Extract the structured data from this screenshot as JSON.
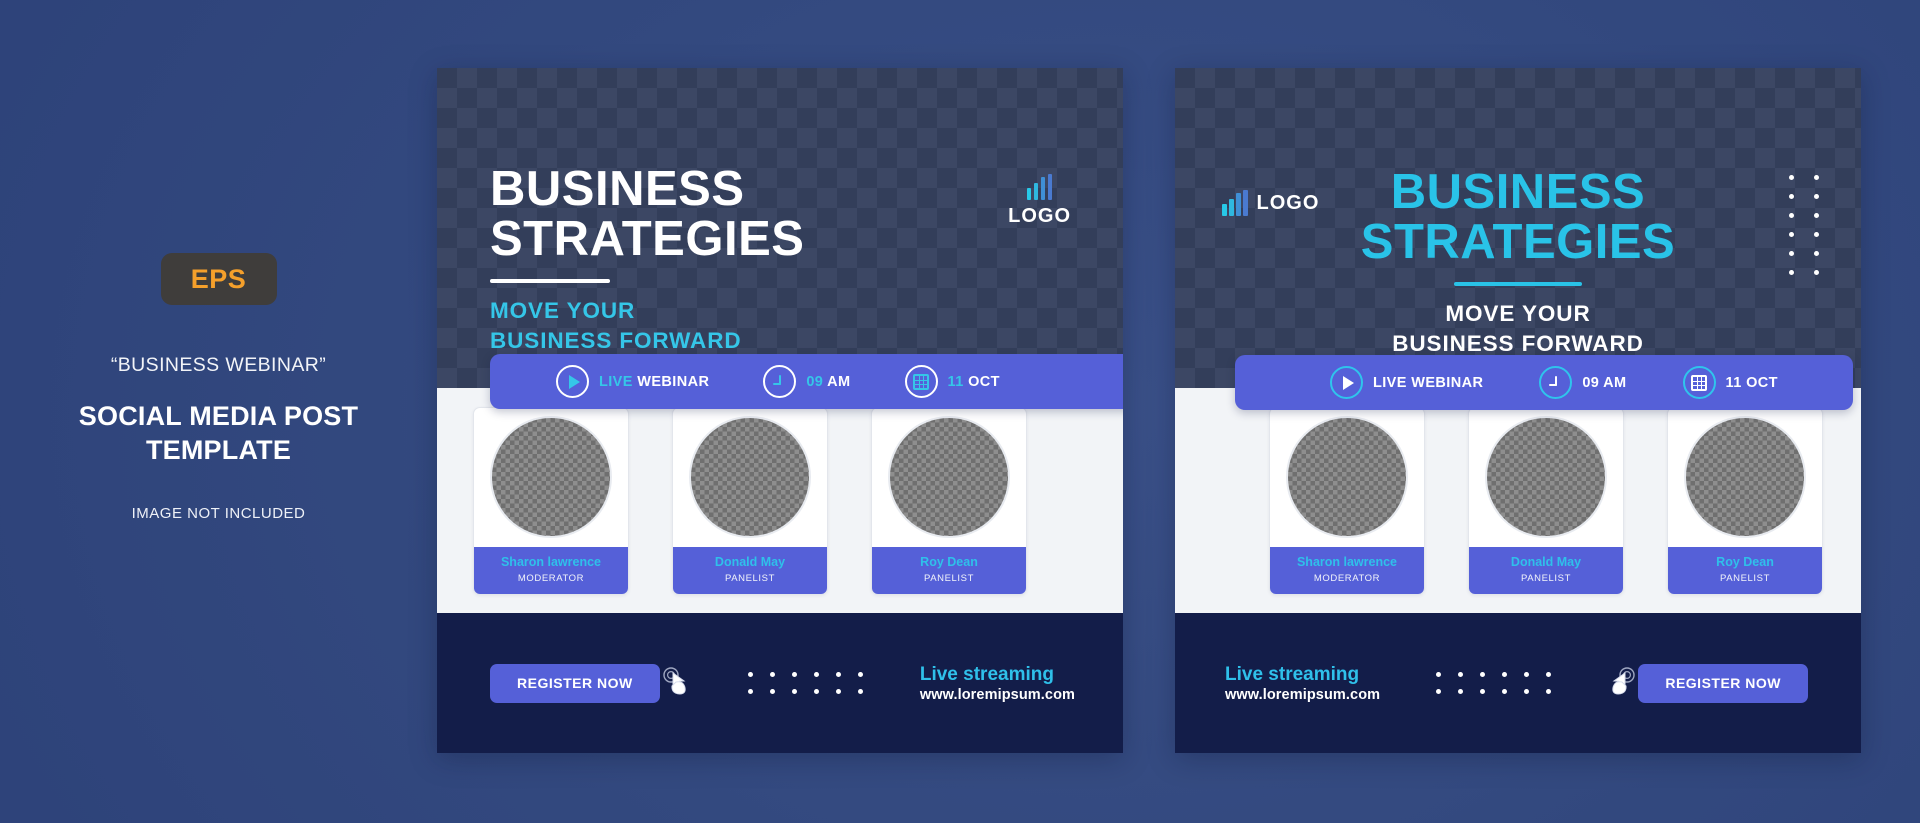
{
  "sidebar": {
    "badge": "EPS",
    "quote": "“BUSINESS WEBINAR”",
    "title_line1": "SOCIAL MEDIA POST",
    "title_line2": "TEMPLATE",
    "note": "IMAGE NOT INCLUDED"
  },
  "poster": {
    "logo_word": "LOGO",
    "headline_line1": "BUSINESS",
    "headline_line2": "STRATEGIES",
    "subhead_line1": "MOVE YOUR",
    "subhead_line2": "BUSINESS FORWARD",
    "info": [
      {
        "icon": "play-icon",
        "highlight": "LIVE",
        "rest": " WEBINAR"
      },
      {
        "icon": "clock-icon",
        "highlight": "09",
        "rest": " AM"
      },
      {
        "icon": "calendar-icon",
        "highlight": "11",
        "rest": " OCT"
      }
    ],
    "speakers": [
      {
        "name": "Sharon lawrence",
        "role": "MODERATOR"
      },
      {
        "name": "Donald May",
        "role": "PANELIST"
      },
      {
        "name": "Roy Dean",
        "role": "PANELIST"
      }
    ],
    "register_label": "REGISTER NOW",
    "stream_title": "Live streaming",
    "stream_url": "www.loremipsum.com"
  },
  "colors": {
    "page_bg": "#33497f",
    "hero_dark": "#333e5a",
    "hero_light": "#3c4764",
    "accent_cyan": "#2fc0ea",
    "accent_blue": "#5560d8",
    "footer_navy": "#131d49",
    "speakers_bg": "#f2f4f7",
    "eps_orange": "#f5a02b"
  }
}
